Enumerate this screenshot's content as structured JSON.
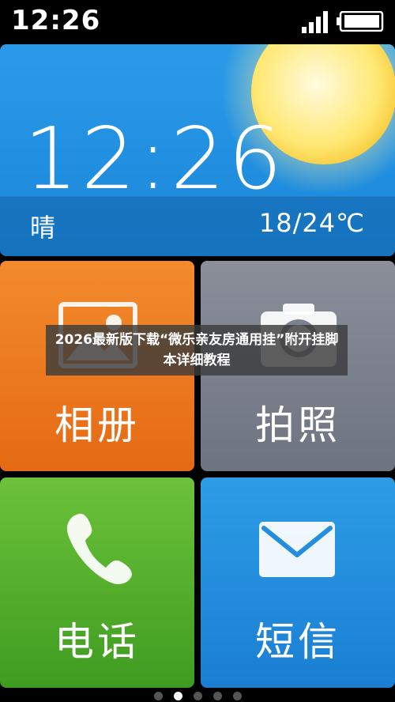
{
  "status_bar": {
    "time": "12:26",
    "icons": [
      "signal-icon",
      "battery-icon"
    ]
  },
  "weather": {
    "time": "12:26",
    "condition": "晴",
    "temperature": "18/24℃",
    "icon": "sun-icon"
  },
  "tiles": [
    {
      "label": "相册",
      "icon": "photo-icon",
      "color": "#ee7a1f"
    },
    {
      "label": "拍照",
      "icon": "camera-icon",
      "color": "#7c818d"
    },
    {
      "label": "电话",
      "icon": "phone-icon",
      "color": "#54ae2c"
    },
    {
      "label": "短信",
      "icon": "mail-icon",
      "color": "#238de0"
    }
  ],
  "banner": {
    "text": "2026最新版下载“微乐亲友房通用挂”附开挂脚本详细教程"
  },
  "pager": {
    "pages": 5,
    "active_page": 2
  }
}
